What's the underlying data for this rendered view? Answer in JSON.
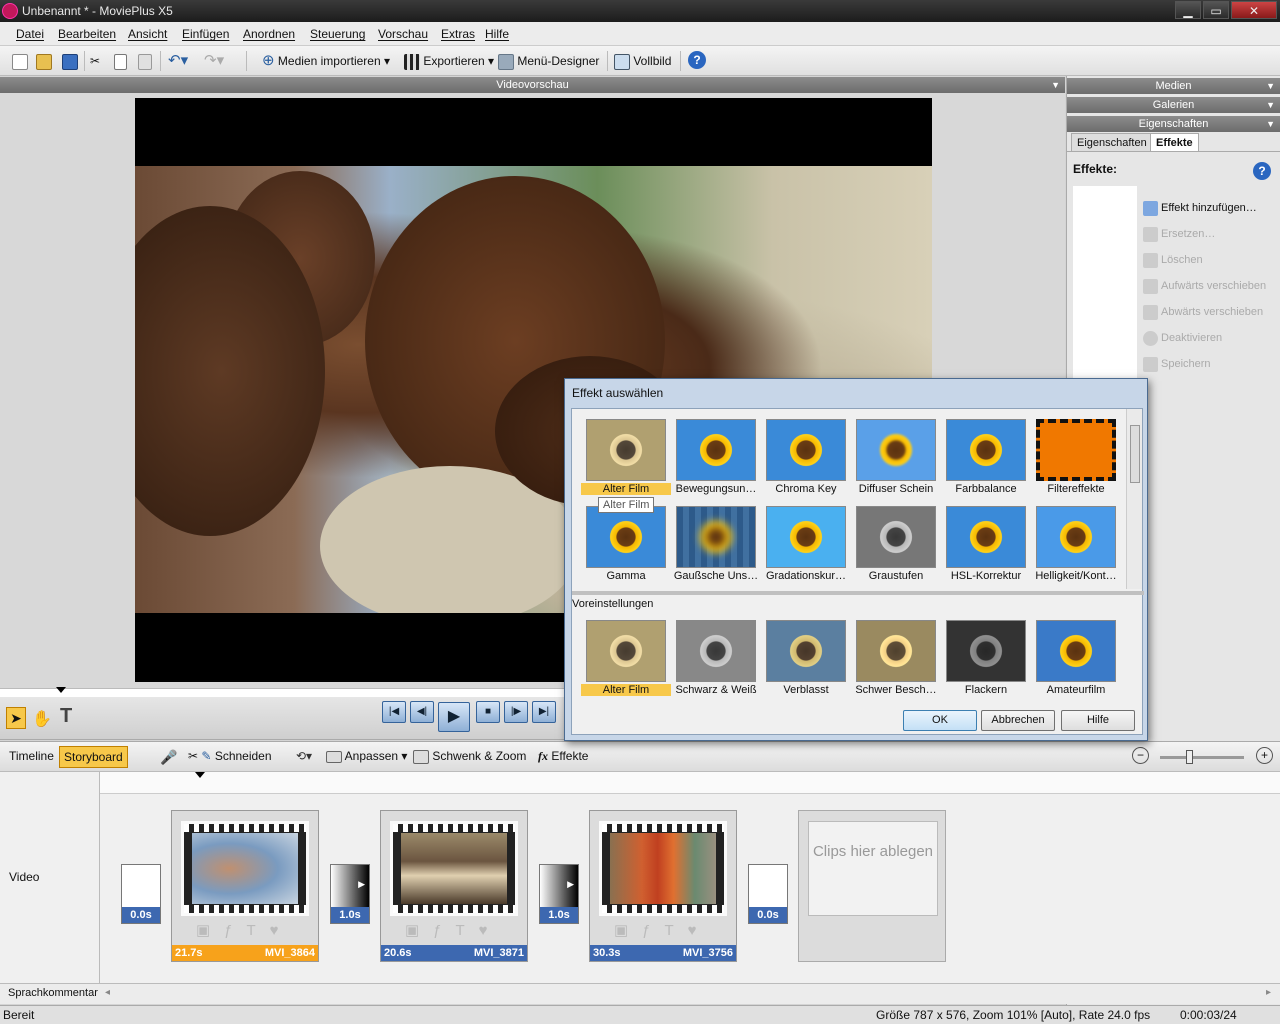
{
  "window": {
    "title": "Unbenannt * - MoviePlus X5",
    "min": "▁",
    "max": "▭",
    "close": "✕"
  },
  "menu": [
    "Datei",
    "Bearbeiten",
    "Ansicht",
    "Einfügen",
    "Anordnen",
    "Steuerung",
    "Vorschau",
    "Extras",
    "Hilfe"
  ],
  "toolbar": {
    "import": "Medien importieren",
    "export": "Exportieren",
    "menu_designer": "Menü-Designer",
    "fullscreen": "Vollbild",
    "help": "?"
  },
  "preview": {
    "header": "Videovorschau"
  },
  "right_panel": {
    "headers": [
      "Medien",
      "Galerien",
      "Eigenschaften"
    ],
    "tabs": [
      "Eigenschaften",
      "Effekte"
    ],
    "effects_label": "Effekte:",
    "actions": [
      "Effekt hinzufügen…",
      "Ersetzen…",
      "Löschen",
      "Aufwärts verschieben",
      "Abwärts verschieben",
      "Deaktivieren",
      "Speichern"
    ]
  },
  "dialog": {
    "title": "Effekt auswählen",
    "effects_row1": [
      "Alter Film",
      "Bewegungsun…",
      "Chroma Key",
      "Diffuser Schein",
      "Farbbalance",
      "Filtereffekte"
    ],
    "effects_row2": [
      "Gamma",
      "Gaußsche Uns…",
      "Gradationskur…",
      "Graustufen",
      "HSL-Korrektur",
      "Helligkeit/Kont…"
    ],
    "tooltip": "Alter Film",
    "presets_label": "Voreinstellungen",
    "presets": [
      "Alter Film",
      "Schwarz & Weiß",
      "Verblasst",
      "Schwer Besch…",
      "Flackern",
      "Amateurfilm"
    ],
    "ok": "OK",
    "cancel": "Abbrechen",
    "help": "Hilfe"
  },
  "story": {
    "tabs": [
      "Timeline",
      "Storyboard"
    ],
    "tools": {
      "cut": "Schneiden",
      "fit": "Anpassen",
      "panzoom": "Schwenk & Zoom",
      "effects": "Effekte"
    },
    "track_video": "Video",
    "track_voice": "Sprachkommentar",
    "clips": [
      {
        "duration": "21.7s",
        "name": "MVI_3864"
      },
      {
        "duration": "20.6s",
        "name": "MVI_3871"
      },
      {
        "duration": "30.3s",
        "name": "MVI_3756"
      }
    ],
    "transitions": [
      "0.0s",
      "1.0s",
      "1.0s",
      "0.0s"
    ],
    "dropzone": "Clips hier ablegen"
  },
  "status": {
    "left": "Bereit",
    "info": "Größe 787 x 576, Zoom 101% [Auto], Rate 24.0 fps",
    "time": "0:00:03/24"
  },
  "colors": {
    "accent_orange": "#f7a21b",
    "clip_blue": "#3d68b0"
  }
}
